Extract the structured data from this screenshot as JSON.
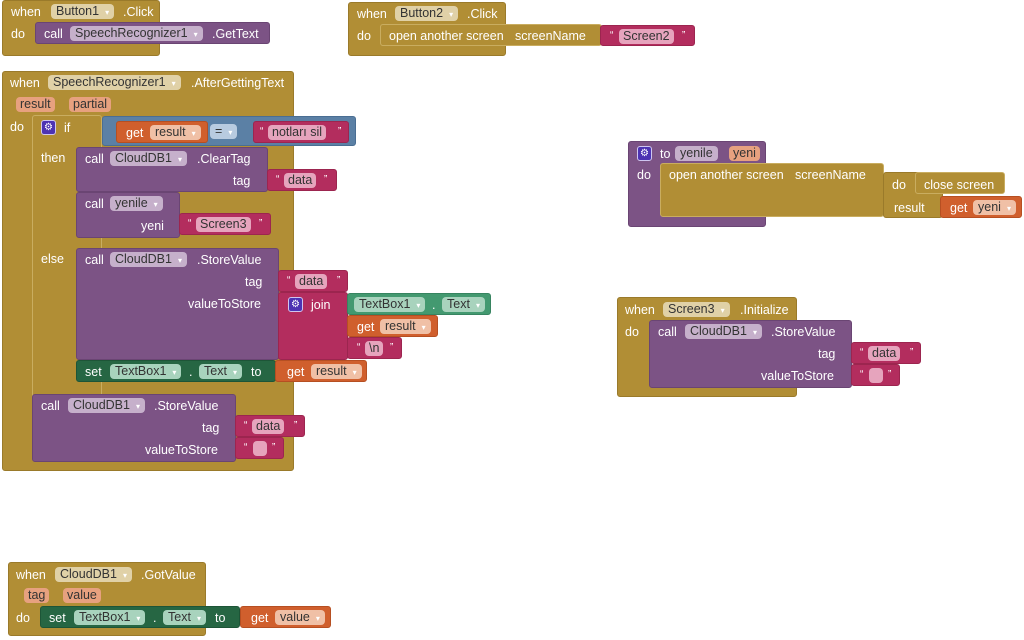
{
  "blocks": {
    "button1_click": {
      "when": "when",
      "component": "Button1",
      "event": ".Click",
      "do": "do",
      "call": {
        "keyword": "call",
        "component": "SpeechRecognizer1",
        "method": ".GetText"
      }
    },
    "button2_click": {
      "when": "when",
      "component": "Button2",
      "event": ".Click",
      "do": "do",
      "open": {
        "label": "open another screen",
        "param": "screenName",
        "value": "Screen2"
      }
    },
    "after_getting_text": {
      "when": "when",
      "component": "SpeechRecognizer1",
      "event": ".AfterGettingText",
      "params": [
        "result",
        "partial"
      ],
      "do": "do",
      "if": {
        "if_label": "if",
        "then_label": "then",
        "else_label": "else",
        "condition": {
          "get": "get",
          "var": "result",
          "op": "=",
          "text": "notları sil"
        },
        "then": [
          {
            "call": "call",
            "component": "CloudDB1",
            "method": ".ClearTag",
            "tag_label": "tag",
            "tag_value": "data"
          },
          {
            "call": "call",
            "proc": "yenile",
            "arg_label": "yeni",
            "arg_value": "Screen3"
          }
        ],
        "else": {
          "store": {
            "call": "call",
            "component": "CloudDB1",
            "method": ".StoreValue",
            "tag_label": "tag",
            "tag_value": "data",
            "value_label": "valueToStore",
            "join": {
              "label": "join",
              "items": [
                {
                  "component": "TextBox1",
                  "property": "Text"
                },
                {
                  "get": "get",
                  "var": "result"
                },
                {
                  "text": "\\n"
                }
              ]
            }
          },
          "set": {
            "set": "set",
            "component": "TextBox1",
            "property": "Text",
            "to": "to",
            "get": "get",
            "var": "result"
          }
        }
      },
      "store2": {
        "call": "call",
        "component": "CloudDB1",
        "method": ".StoreValue",
        "tag_label": "tag",
        "tag_value": "data",
        "value_label": "valueToStore",
        "value": ""
      }
    },
    "proc_yenile": {
      "to": "to",
      "name": "yenile",
      "param": "yeni",
      "do": "do",
      "open": {
        "label": "open another screen",
        "param": "screenName"
      },
      "do_result": {
        "do": "do",
        "close": "close screen",
        "result": "result",
        "get": "get",
        "var": "yeni"
      }
    },
    "screen3_init": {
      "when": "when",
      "component": "Screen3",
      "event": ".Initialize",
      "do": "do",
      "call": {
        "call": "call",
        "component": "CloudDB1",
        "method": ".StoreValue",
        "tag_label": "tag",
        "tag_value": "data",
        "value_label": "valueToStore",
        "value": ""
      }
    },
    "clouddb_gotvalue": {
      "when": "when",
      "component": "CloudDB1",
      "event": ".GotValue",
      "params": [
        "tag",
        "value"
      ],
      "do": "do",
      "set": {
        "set": "set",
        "component": "TextBox1",
        "property": "Text",
        "to": "to",
        "get": "get",
        "var": "value"
      }
    }
  },
  "icons": {
    "dropdown": "▾",
    "gear": "⚙",
    "quote_open": "“",
    "quote_close": "”"
  },
  "colors": {
    "event": "#b18e35",
    "procedure": "#7c5385",
    "text": "#b32d5e",
    "variable": "#d05f2d",
    "logic": "#5b80a5",
    "setter": "#266643",
    "getter": "#439970"
  }
}
